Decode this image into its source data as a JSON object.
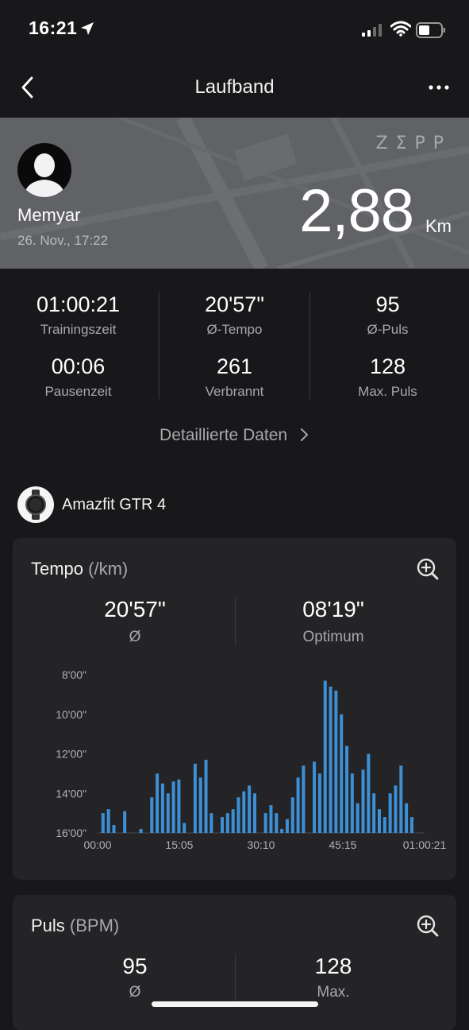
{
  "status": {
    "time": "16:21"
  },
  "nav": {
    "title": "Laufband"
  },
  "hero": {
    "logo": "ZΣPP",
    "user_name": "Memyar",
    "date": "26. Nov., 17:22",
    "distance": "2,88",
    "distance_unit": "Km"
  },
  "stats": [
    {
      "value": "01:00:21",
      "label": "Trainingszeit"
    },
    {
      "value": "20'57\"",
      "label": "Ø-Tempo"
    },
    {
      "value": "95",
      "label": "Ø-Puls"
    },
    {
      "value": "00:06",
      "label": "Pausenzeit"
    },
    {
      "value": "261",
      "label": "Verbrannt"
    },
    {
      "value": "128",
      "label": "Max. Puls"
    }
  ],
  "detail_link": "Detaillierte Daten",
  "device": {
    "name": "Amazfit GTR 4"
  },
  "tempo_card": {
    "title": "Tempo",
    "unit": "(/km)",
    "avg_value": "20'57\"",
    "avg_label": "Ø",
    "best_value": "08'19\"",
    "best_label": "Optimum"
  },
  "chart_data": {
    "type": "area",
    "title": "Tempo (/km)",
    "x_tick_labels": [
      "00:00",
      "15:05",
      "30:10",
      "45:15",
      "01:00:21"
    ],
    "y_tick_labels": [
      "8'00\"",
      "10'00\"",
      "12'00\"",
      "14'00\"",
      "16'00\""
    ],
    "y_range_min_per_km": [
      16,
      8
    ],
    "y_inverted": true,
    "series": [
      {
        "color": "#3d8fd6",
        "x_minutes": [
          1,
          2,
          3,
          4,
          5,
          7,
          8,
          10,
          11,
          12,
          13,
          14,
          15,
          16,
          17,
          18,
          19,
          20,
          21,
          22,
          23,
          24,
          25,
          26,
          27,
          28,
          29,
          31,
          32,
          33,
          34,
          35,
          36,
          37,
          38,
          40,
          41,
          42,
          43,
          44,
          45,
          46,
          47,
          48,
          49,
          50,
          51,
          52,
          53,
          54,
          55,
          56,
          57,
          58,
          59,
          60
        ],
        "pace_minutes": [
          15.0,
          14.8,
          15.6,
          16.0,
          14.9,
          16.0,
          15.8,
          14.2,
          13.0,
          13.5,
          14.0,
          13.4,
          13.3,
          15.5,
          16.0,
          12.5,
          13.2,
          12.3,
          15.0,
          16.0,
          15.2,
          15.0,
          14.8,
          14.2,
          13.9,
          13.6,
          14.0,
          15.0,
          14.6,
          15.0,
          15.8,
          15.3,
          14.2,
          13.2,
          12.6,
          12.4,
          13.0,
          8.3,
          8.6,
          8.8,
          10.0,
          11.6,
          13.0,
          14.5,
          12.8,
          12.0,
          14.0,
          14.8,
          15.2,
          14.0,
          13.6,
          12.6,
          14.5,
          15.2,
          16.0,
          16.0
        ]
      }
    ]
  },
  "puls_card": {
    "title": "Puls",
    "unit": "(BPM)",
    "avg_value": "95",
    "avg_label": "Ø",
    "max_value": "128",
    "max_label": "Max."
  }
}
